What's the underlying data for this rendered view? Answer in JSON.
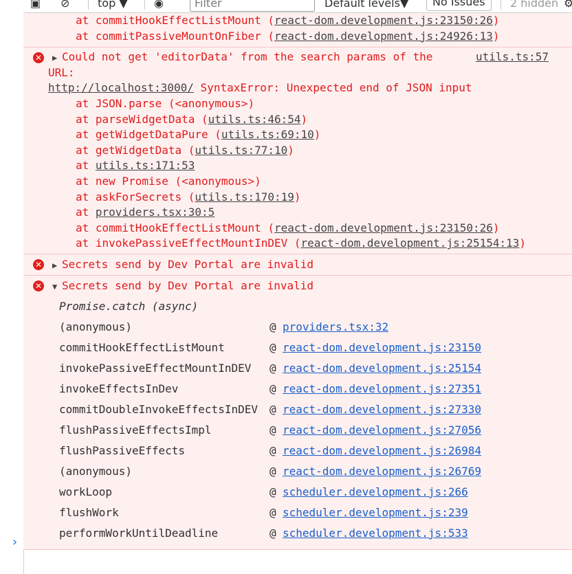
{
  "toolbar": {
    "context": "top",
    "filter_placeholder": "Filter",
    "levels": "Default levels",
    "issues": "No Issues",
    "hidden": "2 hidden"
  },
  "top_lines": [
    {
      "pre": "at commitHookEffectListMount (",
      "link": "react-dom.development.js:23150:26",
      "post": ")"
    },
    {
      "pre": "at commitPassiveMountOnFiber (",
      "link": "react-dom.development.js:24926:13",
      "post": ")"
    }
  ],
  "error1": {
    "line1": "Could not get 'editorData' from the search params of the",
    "source": "utils.ts:57",
    "line2": "URL:",
    "url": "http://localhost:3000/",
    "line3_rest": " SyntaxError: Unexpected end of JSON input",
    "stack": [
      {
        "pre": "at JSON.parse (<anonymous>)",
        "link": "",
        "post": ""
      },
      {
        "pre": "at parseWidgetData (",
        "link": "utils.ts:46:54",
        "post": ")"
      },
      {
        "pre": "at getWidgetDataPure (",
        "link": "utils.ts:69:10",
        "post": ")"
      },
      {
        "pre": "at getWidgetData (",
        "link": "utils.ts:77:10",
        "post": ")"
      },
      {
        "pre": "at ",
        "link": "utils.ts:171:53",
        "post": ""
      },
      {
        "pre": "at new Promise (<anonymous>)",
        "link": "",
        "post": ""
      },
      {
        "pre": "at askForSecrets (",
        "link": "utils.ts:170:19",
        "post": ")"
      },
      {
        "pre": "at ",
        "link": "providers.tsx:30:5",
        "post": ""
      },
      {
        "pre": "at commitHookEffectListMount (",
        "link": "react-dom.development.js:23150:26",
        "post": ")"
      },
      {
        "pre": "at invokePassiveEffectMountInDEV (",
        "link": "react-dom.development.js:25154:13",
        "post": ")"
      }
    ]
  },
  "error2": {
    "text": "Secrets send by Dev Portal are invalid"
  },
  "error3": {
    "text": "Secrets send by Dev Portal are invalid",
    "async_label": "Promise.catch (async)",
    "at_symbol": "@",
    "frames": [
      {
        "fn": "(anonymous)",
        "link": "providers.tsx:32"
      },
      {
        "fn": "commitHookEffectListMount",
        "link": "react-dom.development.js:23150"
      },
      {
        "fn": "invokePassiveEffectMountInDEV",
        "link": "react-dom.development.js:25154"
      },
      {
        "fn": "invokeEffectsInDev",
        "link": "react-dom.development.js:27351"
      },
      {
        "fn": "commitDoubleInvokeEffectsInDEV",
        "link": "react-dom.development.js:27330"
      },
      {
        "fn": "flushPassiveEffectsImpl",
        "link": "react-dom.development.js:27056"
      },
      {
        "fn": "flushPassiveEffects",
        "link": "react-dom.development.js:26984"
      },
      {
        "fn": "(anonymous)",
        "link": "react-dom.development.js:26769"
      },
      {
        "fn": "workLoop",
        "link": "scheduler.development.js:266"
      },
      {
        "fn": "flushWork",
        "link": "scheduler.development.js:239"
      },
      {
        "fn": "performWorkUntilDeadline",
        "link": "scheduler.development.js:533"
      }
    ]
  },
  "prompt": "›",
  "colors": {
    "error_text": "#e11b1b",
    "error_bg": "#fff0f0",
    "link": "#1a5fc9"
  }
}
